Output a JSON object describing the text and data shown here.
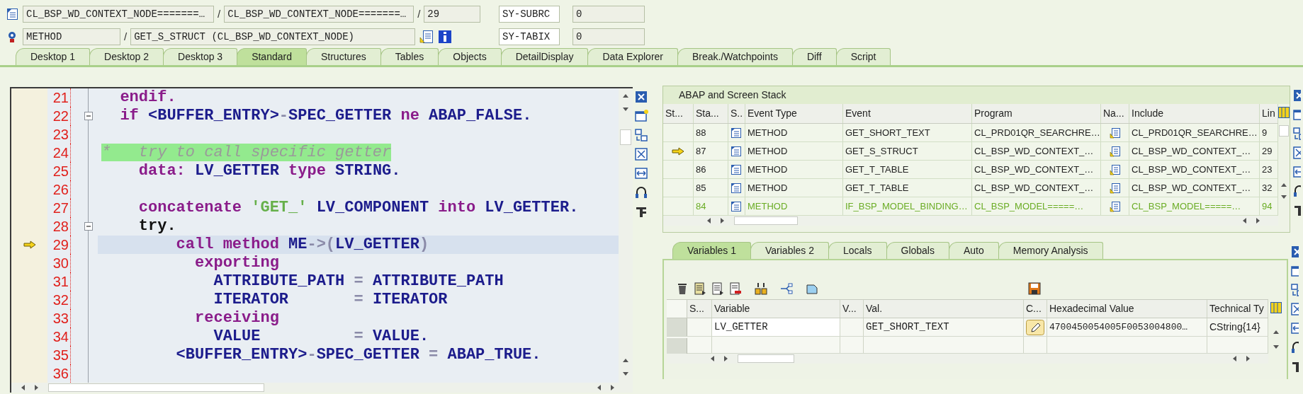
{
  "location": {
    "program": "CL_BSP_WD_CONTEXT_NODE=======…",
    "include": "CL_BSP_WD_CONTEXT_NODE=======…",
    "line": "29",
    "event_type": "METHOD",
    "event": "GET_S_STRUCT (CL_BSP_WD_CONTEXT_NODE)",
    "separators": [
      "/",
      "/",
      "/"
    ]
  },
  "system_fields": [
    {
      "name": "SY-SUBRC",
      "value": "0"
    },
    {
      "name": "SY-TABIX",
      "value": "0"
    }
  ],
  "tabs": [
    {
      "label": "Desktop 1",
      "selected": false
    },
    {
      "label": "Desktop 2",
      "selected": false
    },
    {
      "label": "Desktop 3",
      "selected": false
    },
    {
      "label": "Standard",
      "selected": true
    },
    {
      "label": "Structures",
      "selected": false
    },
    {
      "label": "Tables",
      "selected": false
    },
    {
      "label": "Objects",
      "selected": false
    },
    {
      "label": "DetailDisplay",
      "selected": false
    },
    {
      "label": "Data Explorer",
      "selected": false
    },
    {
      "label": "Break./Watchpoints",
      "selected": false
    },
    {
      "label": "Diff",
      "selected": false
    },
    {
      "label": "Script",
      "selected": false
    }
  ],
  "source": {
    "lines": [
      {
        "number": "21",
        "foldable": false,
        "current": false,
        "tokens": [
          {
            "text": "  endif.",
            "kind": "keyword"
          }
        ]
      },
      {
        "number": "22",
        "foldable": true,
        "current": false,
        "tokens": [
          {
            "text": "  if ",
            "kind": "keyword"
          },
          {
            "text": "<BUFFER_ENTRY>",
            "kind": "identifier"
          },
          {
            "text": "-",
            "kind": "operator"
          },
          {
            "text": "SPEC_GETTER ",
            "kind": "identifier"
          },
          {
            "text": "ne ",
            "kind": "keyword"
          },
          {
            "text": "ABAP_FALSE.",
            "kind": "identifier"
          }
        ]
      },
      {
        "number": "23",
        "foldable": false,
        "current": false
      },
      {
        "number": "24",
        "foldable": false,
        "current": false,
        "tokens": [
          {
            "text": "*   try to call specific getter",
            "kind": "comment"
          }
        ]
      },
      {
        "number": "25",
        "foldable": false,
        "current": false,
        "tokens": [
          {
            "text": "    data: ",
            "kind": "keyword"
          },
          {
            "text": "LV_GETTER ",
            "kind": "identifier"
          },
          {
            "text": "type ",
            "kind": "keyword"
          },
          {
            "text": "STRING.",
            "kind": "identifier"
          }
        ]
      },
      {
        "number": "26",
        "foldable": false,
        "current": false
      },
      {
        "number": "27",
        "foldable": false,
        "current": false,
        "tokens": [
          {
            "text": "    concatenate ",
            "kind": "keyword"
          },
          {
            "text": "'GET_' ",
            "kind": "string"
          },
          {
            "text": "LV_COMPONENT ",
            "kind": "identifier"
          },
          {
            "text": "into ",
            "kind": "keyword"
          },
          {
            "text": "LV_GETTER.",
            "kind": "identifier"
          }
        ]
      },
      {
        "number": "28",
        "foldable": true,
        "current": false,
        "tokens": [
          {
            "text": "    try.",
            "kind": "plain"
          }
        ]
      },
      {
        "number": "29",
        "foldable": false,
        "current": true,
        "tokens": [
          {
            "text": "        call method ",
            "kind": "keyword"
          },
          {
            "text": "ME",
            "kind": "identifier"
          },
          {
            "text": "->(",
            "kind": "operator"
          },
          {
            "text": "LV_GETTER",
            "kind": "identifier"
          },
          {
            "text": ")",
            "kind": "operator"
          }
        ]
      },
      {
        "number": "30",
        "foldable": false,
        "current": false,
        "tokens": [
          {
            "text": "          exporting",
            "kind": "keyword"
          }
        ]
      },
      {
        "number": "31",
        "foldable": false,
        "current": false,
        "tokens": [
          {
            "text": "            ATTRIBUTE_PATH ",
            "kind": "identifier"
          },
          {
            "text": "= ",
            "kind": "operator"
          },
          {
            "text": "ATTRIBUTE_PATH",
            "kind": "identifier"
          }
        ]
      },
      {
        "number": "32",
        "foldable": false,
        "current": false,
        "tokens": [
          {
            "text": "            ITERATOR       ",
            "kind": "identifier"
          },
          {
            "text": "= ",
            "kind": "operator"
          },
          {
            "text": "ITERATOR",
            "kind": "identifier"
          }
        ]
      },
      {
        "number": "33",
        "foldable": false,
        "current": false,
        "tokens": [
          {
            "text": "          receiving",
            "kind": "keyword"
          }
        ]
      },
      {
        "number": "34",
        "foldable": false,
        "current": false,
        "tokens": [
          {
            "text": "            VALUE          ",
            "kind": "identifier"
          },
          {
            "text": "= ",
            "kind": "operator"
          },
          {
            "text": "VALUE.",
            "kind": "identifier"
          }
        ]
      },
      {
        "number": "35",
        "foldable": false,
        "current": false,
        "tokens": [
          {
            "text": "        <BUFFER_ENTRY>",
            "kind": "identifier"
          },
          {
            "text": "-",
            "kind": "operator"
          },
          {
            "text": "SPEC_GETTER ",
            "kind": "identifier"
          },
          {
            "text": "= ",
            "kind": "operator"
          },
          {
            "text": "ABAP_TRUE.",
            "kind": "identifier"
          }
        ]
      },
      {
        "number": "36",
        "foldable": false,
        "current": false
      }
    ]
  },
  "stack": {
    "title": "ABAP and Screen Stack",
    "columns": [
      "St...",
      "Sta...",
      "S..",
      "Event Type",
      "Event",
      "Program",
      "Na...",
      "Include",
      "Lin"
    ],
    "rows": [
      {
        "current": false,
        "inactive": false,
        "level": "88",
        "event_type": "METHOD",
        "event": "GET_SHORT_TEXT",
        "program": "CL_PRD01QR_SEARCHRE…",
        "include": "CL_PRD01QR_SEARCHRE…",
        "line": "9"
      },
      {
        "current": true,
        "inactive": false,
        "level": "87",
        "event_type": "METHOD",
        "event": "GET_S_STRUCT",
        "program": "CL_BSP_WD_CONTEXT_…",
        "include": "CL_BSP_WD_CONTEXT_…",
        "line": "29"
      },
      {
        "current": false,
        "inactive": false,
        "level": "86",
        "event_type": "METHOD",
        "event": "GET_T_TABLE",
        "program": "CL_BSP_WD_CONTEXT_…",
        "include": "CL_BSP_WD_CONTEXT_…",
        "line": "23"
      },
      {
        "current": false,
        "inactive": false,
        "level": "85",
        "event_type": "METHOD",
        "event": "GET_T_TABLE",
        "program": "CL_BSP_WD_CONTEXT_…",
        "include": "CL_BSP_WD_CONTEXT_…",
        "line": "32"
      },
      {
        "current": false,
        "inactive": true,
        "level": "84",
        "event_type": "METHOD",
        "event": "IF_BSP_MODEL_BINDING…",
        "program": "CL_BSP_MODEL=====…",
        "include": "CL_BSP_MODEL=====…",
        "line": "94"
      }
    ]
  },
  "variables": {
    "tabs": [
      {
        "label": "Variables 1",
        "selected": true
      },
      {
        "label": "Variables 2",
        "selected": false
      },
      {
        "label": "Locals",
        "selected": false
      },
      {
        "label": "Globals",
        "selected": false
      },
      {
        "label": "Auto",
        "selected": false
      },
      {
        "label": "Memory Analysis",
        "selected": false
      }
    ],
    "columns": [
      "S...",
      "Variable",
      "V...",
      "Val.",
      "C...",
      "Hexadecimal Value",
      "Technical Ty"
    ],
    "rows": [
      {
        "variable": "LV_GETTER",
        "value": "GET_SHORT_TEXT",
        "hex": "4700450054005F0053004800…",
        "type": "CString{14}"
      }
    ]
  }
}
